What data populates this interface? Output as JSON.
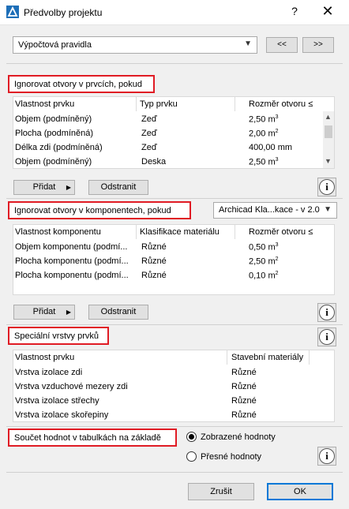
{
  "window": {
    "title": "Předvolby projektu",
    "help_label": "?",
    "close_label": "✕"
  },
  "top": {
    "preset_select_value": "Výpočtová pravidla",
    "prev_label": "<<",
    "next_label": ">>"
  },
  "section1": {
    "header": "Ignorovat otvory v prvcích, pokud",
    "columns": [
      "Vlastnost prvku",
      "Typ prvku",
      "Rozměr otvoru ≤"
    ],
    "rows": [
      {
        "property": "Objem (podmíněný)",
        "type": "Zeď",
        "size": "2,50 m",
        "unit_sup": "3"
      },
      {
        "property": "Plocha (podmíněná)",
        "type": "Zeď",
        "size": "2,00 m",
        "unit_sup": "2"
      },
      {
        "property": "Délka zdi (podmíněná)",
        "type": "Zeď",
        "size": "400,00 mm",
        "unit_sup": ""
      },
      {
        "property": "Objem (podmíněný)",
        "type": "Deska",
        "size": "2,50 m",
        "unit_sup": "3"
      }
    ],
    "add_label": "Přidat",
    "remove_label": "Odstranit"
  },
  "section2": {
    "header": "Ignorovat otvory v komponentech, pokud",
    "classification_select": "Archicad Kla...kace - v 2.0",
    "columns": [
      "Vlastnost komponentu",
      "Klasifikace materiálu",
      "Rozměr otvoru ≤"
    ],
    "rows": [
      {
        "property": "Objem komponentu (podmí...",
        "classification": "Různé",
        "size": "0,50 m",
        "unit_sup": "3"
      },
      {
        "property": "Plocha komponentu (podmí...",
        "classification": "Různé",
        "size": "2,50 m",
        "unit_sup": "2"
      },
      {
        "property": "Plocha komponentu (podmí...",
        "classification": "Různé",
        "size": "0,10 m",
        "unit_sup": "2"
      }
    ],
    "add_label": "Přidat",
    "remove_label": "Odstranit"
  },
  "section3": {
    "header": "Speciální vrstvy prvků",
    "columns": [
      "Vlastnost prvku",
      "Stavební materiály"
    ],
    "rows": [
      {
        "property": "Vrstva izolace zdi",
        "material": "Různé"
      },
      {
        "property": "Vrstva vzduchové mezery zdi",
        "material": "Různé"
      },
      {
        "property": "Vrstva izolace střechy",
        "material": "Různé"
      },
      {
        "property": "Vrstva izolace skořepiny",
        "material": "Různé"
      }
    ]
  },
  "section4": {
    "header": "Součet hodnot v tabulkách na základě",
    "option_displayed": "Zobrazené hodnoty",
    "option_exact": "Přesné hodnoty",
    "selected": "displayed"
  },
  "footer": {
    "cancel_label": "Zrušit",
    "ok_label": "OK"
  },
  "info_glyph": "i",
  "colors": {
    "highlight": "#e01b24",
    "ok_border": "#0078d7"
  }
}
